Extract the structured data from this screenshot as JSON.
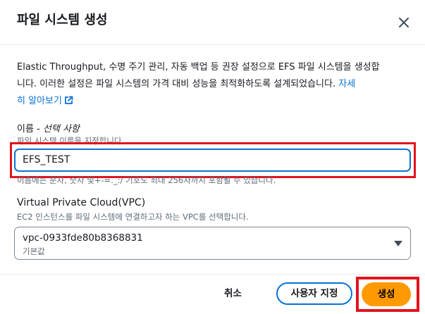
{
  "modal": {
    "title": "파일 시스템 생성",
    "description_line1": "Elastic Throughput, 수명 주기 관리, 자동 백업 등 권장 설정으로 EFS 파일 시스템을 생성합",
    "description_line2": "니다. 이러한 설정은 파일 시스템의 가격 대비 성능을 최적화하도록 설계되었습니다.",
    "learn_more_part1": "자세",
    "learn_more_part2": "히 알아보기"
  },
  "name_field": {
    "label": "이름",
    "label_separator": " - ",
    "optional": "선택 사항",
    "hint": "파일 시스템 이름을 지정합니다.",
    "value": "EFS_TEST",
    "constraint": "이름에는 문자, 숫자 및+-=._:/ 기호도 최대 256자까지 포함될 수 있습니다."
  },
  "vpc_field": {
    "label": "Virtual Private Cloud(VPC)",
    "hint": "EC2 인스턴스를 파일 시스템에 연결하고자 하는 VPC를 선택합니다.",
    "selected_value": "vpc-0933fde80b8368831",
    "selected_sub": "기본값"
  },
  "footer": {
    "cancel_label": "취소",
    "customize_label": "사용자 지정",
    "create_label": "생성"
  },
  "colors": {
    "primary_orange": "#ff9900",
    "link_blue": "#0972d3",
    "highlight_red": "#e0141e"
  },
  "icons": [
    "close-icon",
    "external-link-icon",
    "caret-down-icon"
  ]
}
